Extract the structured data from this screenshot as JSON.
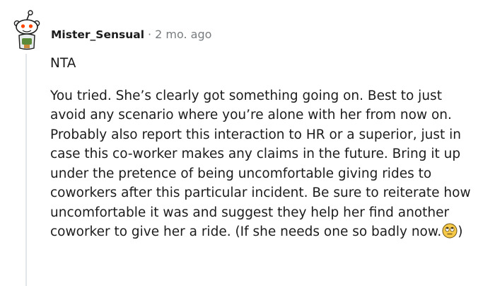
{
  "comment": {
    "author": "Mister_Sensual",
    "separator": "·",
    "time_ago": "2 mo. ago",
    "verdict": "NTA",
    "text_before_emoji": "You tried. She’s clearly got something going on. Best to just avoid any scenario where you’re alone with her from now on. Probably also report this interaction to HR or a superior, just in case this co-worker makes any claims in the future. Bring it up under the pretence of being uncomfortable giving rides to coworkers after this particular incident. Be sure to reiterate how uncomfortable it was and suggest they help her find another coworker to give her a ride. (If she needs one so badly now.",
    "text_after_emoji": ")",
    "emoji_icon": "face-with-rolling-eyes-icon",
    "avatar_icon": "snoo-avatar-icon"
  },
  "colors": {
    "text": "#1c1c1c",
    "muted": "#787c7e",
    "thread_line": "#e3e6e8",
    "emoji_face": "#f7c948"
  }
}
